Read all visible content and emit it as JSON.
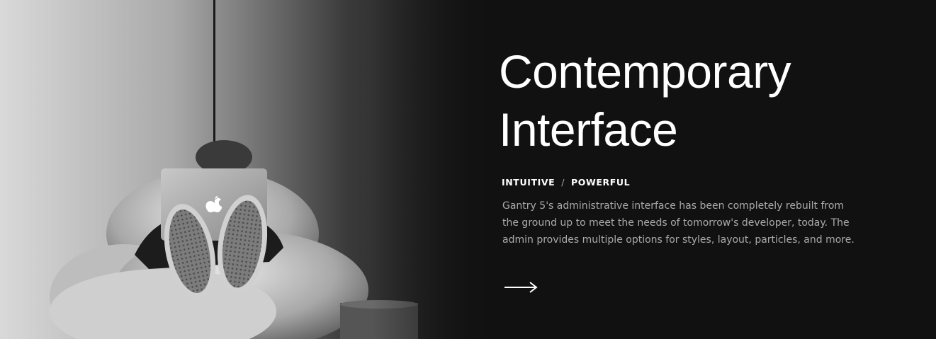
{
  "hero": {
    "title_line1": "Contemporary",
    "title_line2": "Interface",
    "tag1": "INTUITIVE",
    "separator": "/",
    "tag2": "POWERFUL",
    "description": "Gantry 5's administrative interface has been completely rebuilt from the ground up to meet the needs of tomorrow's developer, today. The admin provides multiple options for styles, layout, particles, and more."
  },
  "colors": {
    "background": "#111111",
    "title": "#ffffff",
    "text": "#aaaaaa"
  },
  "icons": {
    "arrow": "right-arrow-icon"
  }
}
